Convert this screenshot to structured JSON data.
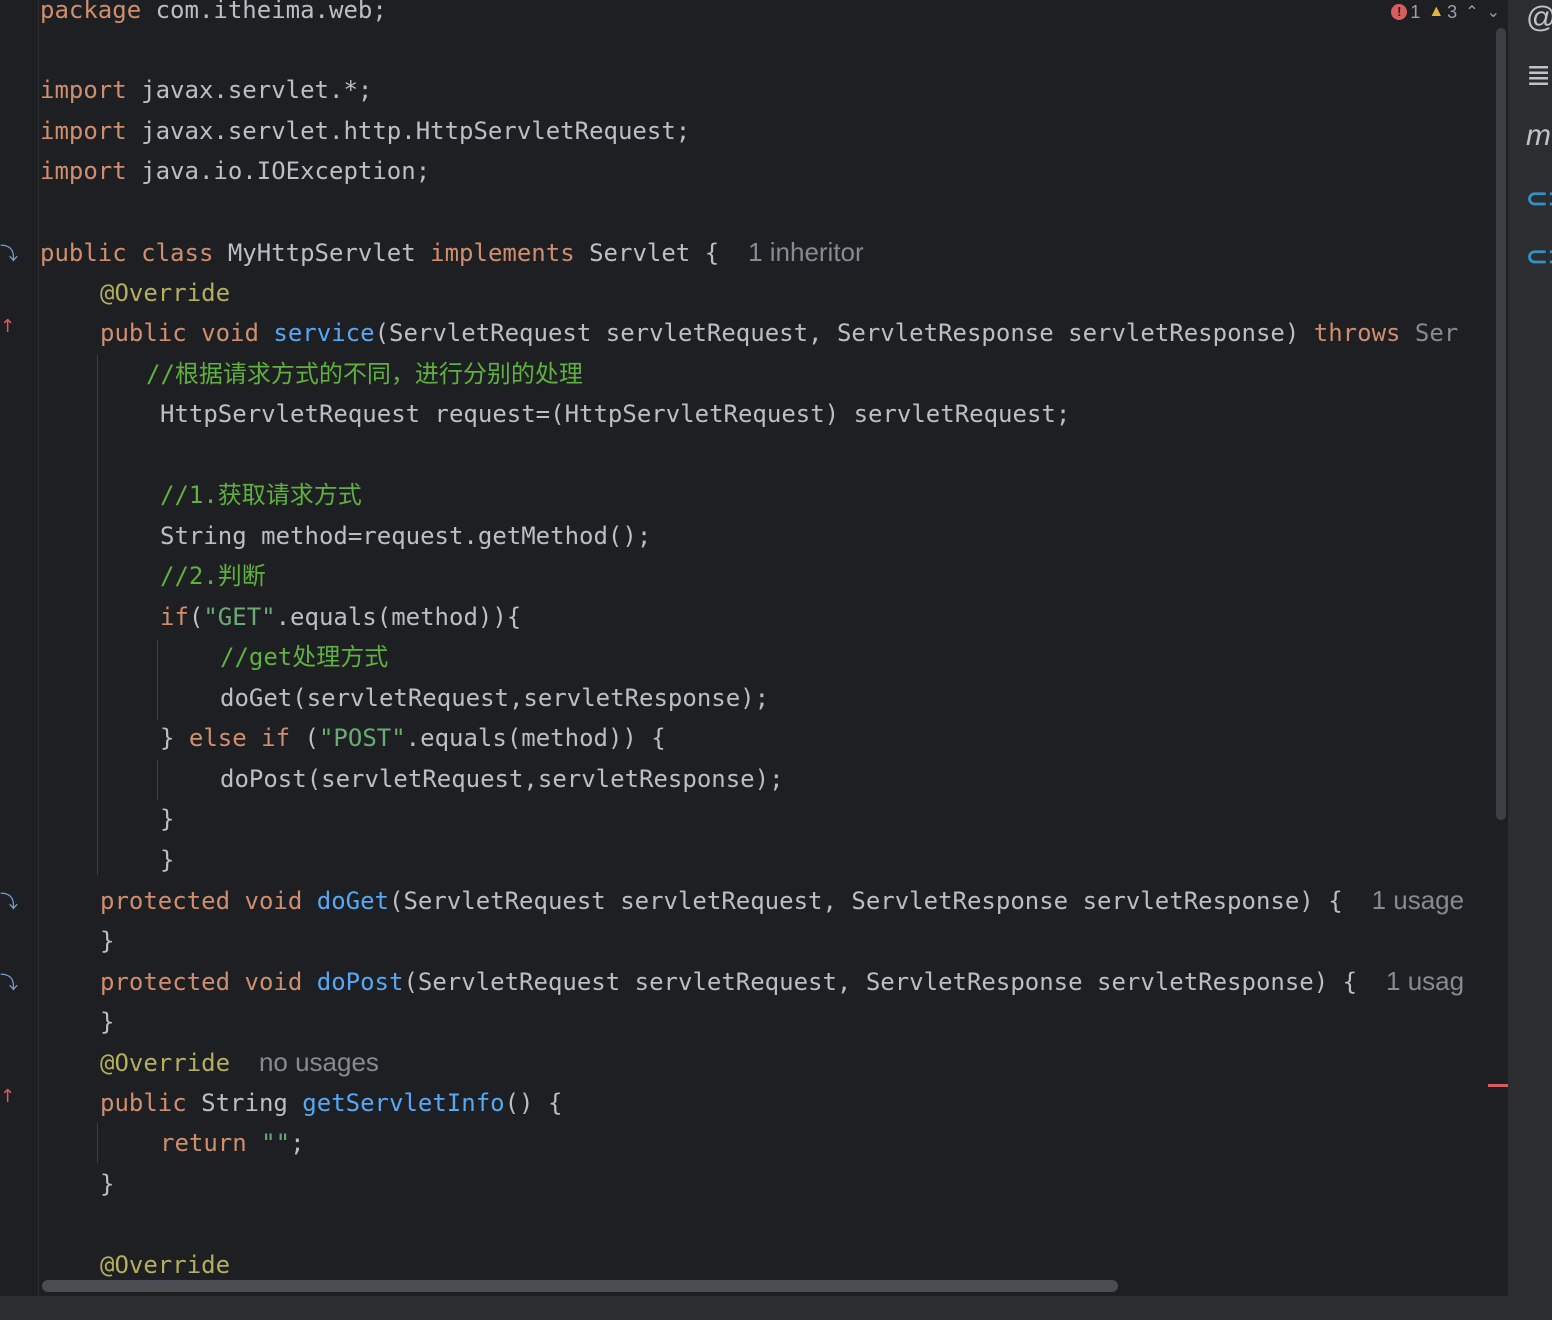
{
  "inspection": {
    "errors": "1",
    "warnings": "3"
  },
  "side_toolbar": [
    "ai-assistant-icon",
    "database-icon",
    "maven-icon",
    "endpoints-icon",
    "services-icon"
  ],
  "code": {
    "package_kw": "package",
    "package_name": " com.itheima.web;",
    "import_kw": "import",
    "import1": " javax.servlet.*;",
    "import2": " javax.servlet.http.HttpServletRequest;",
    "import3": " java.io.IOException;",
    "class_public": "public",
    "class_kw": "class",
    "class_name": "MyHttpServlet",
    "implements_kw": "implements",
    "interface": "Servlet {",
    "class_hint": "1 inheritor",
    "override": "@Override",
    "service_mods": "public void",
    "service_name": "service",
    "service_params": "(ServletRequest servletRequest, ServletResponse servletResponse)",
    "throws_kw": "throws",
    "throws_trunc": "Ser",
    "comment1": "//根据请求方式的不同，进行分别的处理",
    "cast_line": "HttpServletRequest request=(HttpServletRequest) servletRequest;",
    "comment2": "//1.获取请求方式",
    "method_line": "String method=request.getMethod();",
    "comment3": "//2.判断",
    "if_kw": "if",
    "if_open": "(",
    "get_str": "\"GET\"",
    "if_rest": ".equals(method)){",
    "comment4": "//get处理方式",
    "doget_call": "doGet(servletRequest,servletResponse);",
    "brace_close": "}",
    "else_kw": "else if",
    "else_open": " (",
    "post_str": "\"POST\"",
    "else_rest": ".equals(method)) {",
    "dopost_call": "doPost(servletRequest,servletResponse);",
    "protected_void": "protected void",
    "doget_name": "doGet",
    "doget_params": "(ServletRequest servletRequest, ServletResponse servletResponse) {",
    "dopost_name": "doPost",
    "dopost_params": "(ServletRequest servletRequest, ServletResponse servletResponse) {",
    "usage_hint": "1 usage",
    "usage_hint_trunc": "1 usag",
    "no_usages": "no usages",
    "public_kw": "public",
    "string_type": " String ",
    "info_name": "getServletInfo",
    "info_rest": "() {",
    "return_kw": "return",
    "empty_str": "\"\"",
    "semicolon": ";"
  }
}
